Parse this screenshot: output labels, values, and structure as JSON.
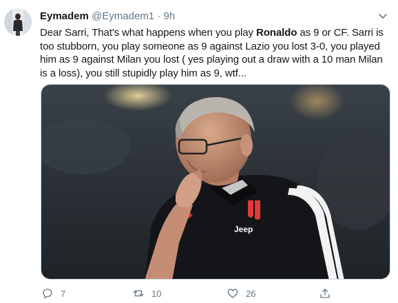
{
  "tweet": {
    "author": {
      "name": "Eymadem",
      "handle": "@Eymadem1",
      "separator": "·",
      "time": "9h"
    },
    "text": {
      "part1": "Dear Sarri, That's what happens when you play ",
      "bold": "Ronaldo",
      "part2": " as 9 or CF. Sarri is too stubborn, you play someone as 9 against Lazio you lost 3-0, you played him as 9 against Milan you lost ( yes playing out a draw with a 10 man Milan is a loss), you still stupidly play him as 9, wtf..."
    },
    "media": {
      "jersey_text": "Jeep"
    },
    "actions": {
      "reply_count": "7",
      "retweet_count": "10",
      "like_count": "26"
    }
  },
  "icons": {
    "caret": "chevron-down-icon",
    "reply": "reply-icon",
    "retweet": "retweet-icon",
    "like": "heart-icon",
    "share": "share-icon"
  },
  "colors": {
    "text": "#14171a",
    "secondary": "#657786",
    "border": "#ccd6dd"
  }
}
